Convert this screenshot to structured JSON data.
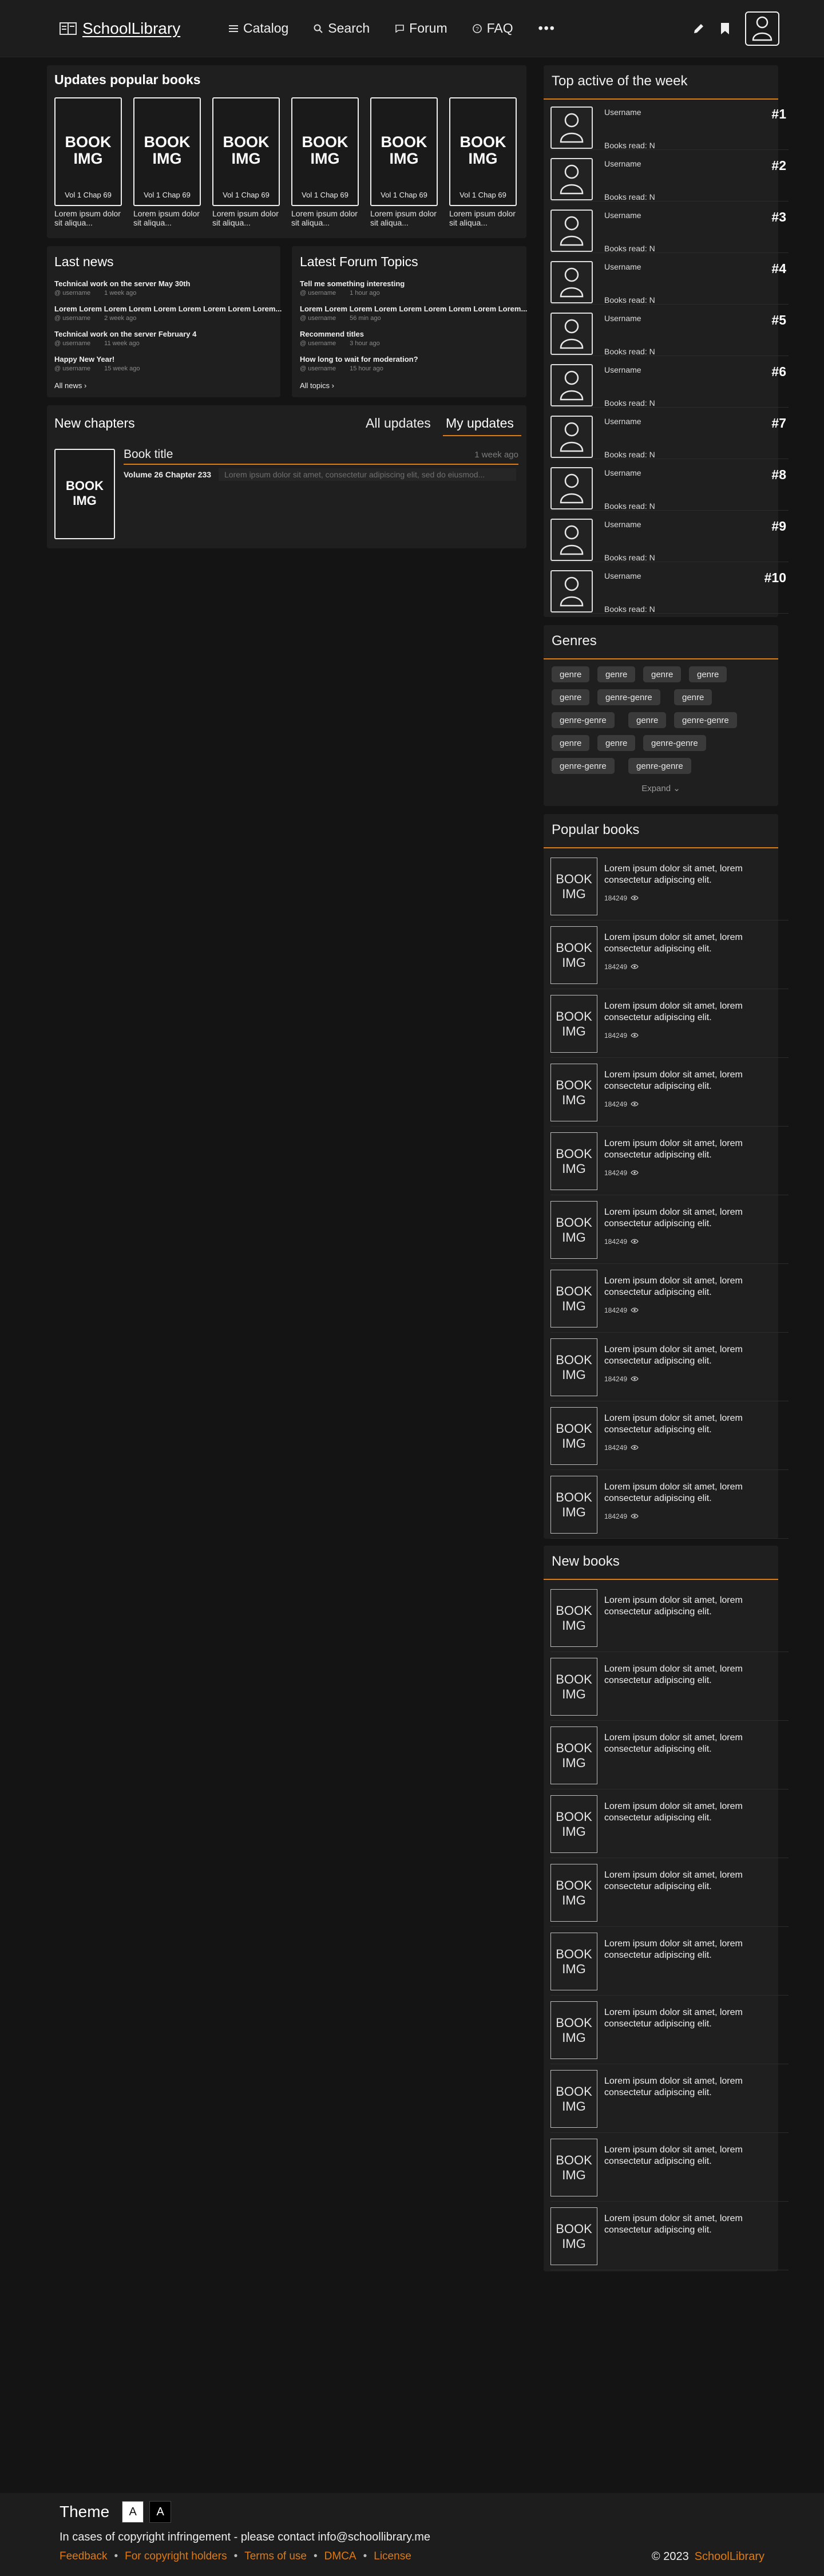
{
  "header": {
    "logo_text": "SchoolLibrary",
    "nav": [
      {
        "label": "Catalog",
        "icon": "menu-icon"
      },
      {
        "label": "Search",
        "icon": "search-icon"
      },
      {
        "label": "Forum",
        "icon": "chat-icon"
      },
      {
        "label": "FAQ",
        "icon": "help-icon"
      }
    ],
    "more_label": "•••",
    "icons": [
      "pencil-icon",
      "bookmark-icon",
      "user-icon"
    ]
  },
  "updates": {
    "title": "Updates popular books",
    "books": [
      {
        "img": "BOOK IMG",
        "chapter": "Vol 1 Chap 69",
        "caption": "Lorem ipsum dolor sit aliqua..."
      },
      {
        "img": "BOOK IMG",
        "chapter": "Vol 1 Chap 69",
        "caption": "Lorem ipsum dolor sit aliqua..."
      },
      {
        "img": "BOOK IMG",
        "chapter": "Vol 1 Chap 69",
        "caption": "Lorem ipsum dolor sit aliqua..."
      },
      {
        "img": "BOOK IMG",
        "chapter": "Vol 1 Chap 69",
        "caption": "Lorem ipsum dolor sit aliqua..."
      },
      {
        "img": "BOOK IMG",
        "chapter": "Vol 1 Chap 69",
        "caption": "Lorem ipsum dolor sit aliqua..."
      },
      {
        "img": "BOOK IMG",
        "chapter": "Vol 1 Chap 69",
        "caption": "Lorem ipsum dolor sit aliqua..."
      }
    ]
  },
  "news": {
    "title": "Last news",
    "items": [
      {
        "title": "Technical work on the server May 30th",
        "user": "@ username",
        "time": "1 week ago"
      },
      {
        "title": "Lorem Lorem Lorem Lorem Lorem Lorem Lorem Lorem Lorem...",
        "user": "@ username",
        "time": "2 week ago"
      },
      {
        "title": "Technical work on the server February 4",
        "user": "@ username",
        "time": "11 week ago"
      },
      {
        "title": "Happy New Year!",
        "user": "@ username",
        "time": "15 week ago"
      }
    ],
    "all_link": "All news ›"
  },
  "forum": {
    "title": "Latest Forum Topics",
    "items": [
      {
        "title": "Tell me something interesting",
        "user": "@ username",
        "time": "1 hour ago"
      },
      {
        "title": "Lorem Lorem Lorem Lorem Lorem Lorem Lorem Lorem Lorem...",
        "user": "@ username",
        "time": "56 min ago"
      },
      {
        "title": "Recommend titles",
        "user": "@ username",
        "time": "3 hour ago"
      },
      {
        "title": "How long to wait for moderation?",
        "user": "@ username",
        "time": "15 hour ago"
      }
    ],
    "all_link": "All topics ›"
  },
  "chapters": {
    "title": "New chapters",
    "tabs": [
      "All updates",
      "My updates"
    ],
    "item": {
      "img": "BOOK IMG",
      "book_title": "Book title",
      "time": "1 week ago",
      "volume": "Volume 26 Chapter 233",
      "desc": "Lorem ipsum dolor sit amet, consectetur adipiscing elit, sed do eiusmod..."
    }
  },
  "top_active": {
    "title": "Top active of the week",
    "rows": [
      {
        "username": "Username",
        "books": "Books read: N",
        "rank": "#1"
      },
      {
        "username": "Username",
        "books": "Books read: N",
        "rank": "#2"
      },
      {
        "username": "Username",
        "books": "Books read: N",
        "rank": "#3"
      },
      {
        "username": "Username",
        "books": "Books read: N",
        "rank": "#4"
      },
      {
        "username": "Username",
        "books": "Books read: N",
        "rank": "#5"
      },
      {
        "username": "Username",
        "books": "Books read: N",
        "rank": "#6"
      },
      {
        "username": "Username",
        "books": "Books read: N",
        "rank": "#7"
      },
      {
        "username": "Username",
        "books": "Books read: N",
        "rank": "#8"
      },
      {
        "username": "Username",
        "books": "Books read: N",
        "rank": "#9"
      },
      {
        "username": "Username",
        "books": "Books read: N",
        "rank": "#10"
      }
    ]
  },
  "genres": {
    "title": "Genres",
    "chips": [
      "genre",
      "genre",
      "genre",
      "genre",
      "genre",
      "genre-genre",
      "genre",
      "genre-genre",
      "genre",
      "genre-genre",
      "genre",
      "genre",
      "genre-genre",
      "genre-genre",
      "genre-genre"
    ],
    "expand": "Expand ⌄"
  },
  "popular": {
    "title": "Popular books",
    "items": [
      {
        "img": "BOOK IMG",
        "desc": "Lorem ipsum dolor sit amet, lorem consectetur adipiscing elit.",
        "views": "184249"
      },
      {
        "img": "BOOK IMG",
        "desc": "Lorem ipsum dolor sit amet, lorem consectetur adipiscing elit.",
        "views": "184249"
      },
      {
        "img": "BOOK IMG",
        "desc": "Lorem ipsum dolor sit amet, lorem consectetur adipiscing elit.",
        "views": "184249"
      },
      {
        "img": "BOOK IMG",
        "desc": "Lorem ipsum dolor sit amet, lorem consectetur adipiscing elit.",
        "views": "184249"
      },
      {
        "img": "BOOK IMG",
        "desc": "Lorem ipsum dolor sit amet, lorem consectetur adipiscing elit.",
        "views": "184249"
      },
      {
        "img": "BOOK IMG",
        "desc": "Lorem ipsum dolor sit amet, lorem consectetur adipiscing elit.",
        "views": "184249"
      },
      {
        "img": "BOOK IMG",
        "desc": "Lorem ipsum dolor sit amet, lorem consectetur adipiscing elit.",
        "views": "184249"
      },
      {
        "img": "BOOK IMG",
        "desc": "Lorem ipsum dolor sit amet, lorem consectetur adipiscing elit.",
        "views": "184249"
      },
      {
        "img": "BOOK IMG",
        "desc": "Lorem ipsum dolor sit amet, lorem consectetur adipiscing elit.",
        "views": "184249"
      },
      {
        "img": "BOOK IMG",
        "desc": "Lorem ipsum dolor sit amet, lorem consectetur adipiscing elit.",
        "views": "184249"
      }
    ]
  },
  "new_books": {
    "title": "New books",
    "items": [
      {
        "img": "BOOK IMG",
        "desc": "Lorem ipsum dolor sit amet, lorem consectetur adipiscing elit."
      },
      {
        "img": "BOOK IMG",
        "desc": "Lorem ipsum dolor sit amet, lorem consectetur adipiscing elit."
      },
      {
        "img": "BOOK IMG",
        "desc": "Lorem ipsum dolor sit amet, lorem consectetur adipiscing elit."
      },
      {
        "img": "BOOK IMG",
        "desc": "Lorem ipsum dolor sit amet, lorem consectetur adipiscing elit."
      },
      {
        "img": "BOOK IMG",
        "desc": "Lorem ipsum dolor sit amet, lorem consectetur adipiscing elit."
      },
      {
        "img": "BOOK IMG",
        "desc": "Lorem ipsum dolor sit amet, lorem consectetur adipiscing elit."
      },
      {
        "img": "BOOK IMG",
        "desc": "Lorem ipsum dolor sit amet, lorem consectetur adipiscing elit."
      },
      {
        "img": "BOOK IMG",
        "desc": "Lorem ipsum dolor sit amet, lorem consectetur adipiscing elit."
      },
      {
        "img": "BOOK IMG",
        "desc": "Lorem ipsum dolor sit amet, lorem consectetur adipiscing elit."
      },
      {
        "img": "BOOK IMG",
        "desc": "Lorem ipsum dolor sit amet, lorem consectetur adipiscing elit."
      }
    ]
  },
  "footer": {
    "theme_label": "Theme",
    "theme_light": "A",
    "theme_dark": "A",
    "copyright_notice": "In cases of copyright infringement - please contact info@schoollibrary.me",
    "links": [
      "Feedback",
      "For copyright holders",
      "Terms of use",
      "DMCA",
      "License"
    ],
    "copy": "© 2023",
    "brand": "SchoolLibrary"
  },
  "colors": {
    "accent": "#e07a14",
    "background": "#141414",
    "panel": "#1f1f1f"
  }
}
